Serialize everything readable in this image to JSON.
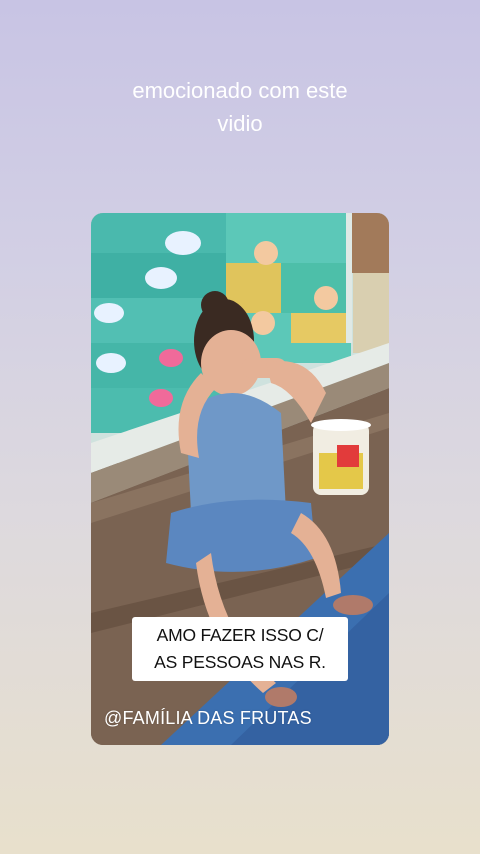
{
  "story": {
    "caption_line1": "emocionado com este",
    "caption_line2": "vidio"
  },
  "media": {
    "sticker_line1": "AMO FAZER ISSO C/",
    "sticker_line2": "AS PESSOAS NAS R.",
    "handle": "@FAMÍLIA DAS FRUTAS"
  },
  "colors": {
    "background_top": "#c8c4e4",
    "background_bottom": "#e8e0cc",
    "caption_text": "#ffffff",
    "sticker_bg": "#ffffff",
    "sticker_text": "#111111"
  }
}
